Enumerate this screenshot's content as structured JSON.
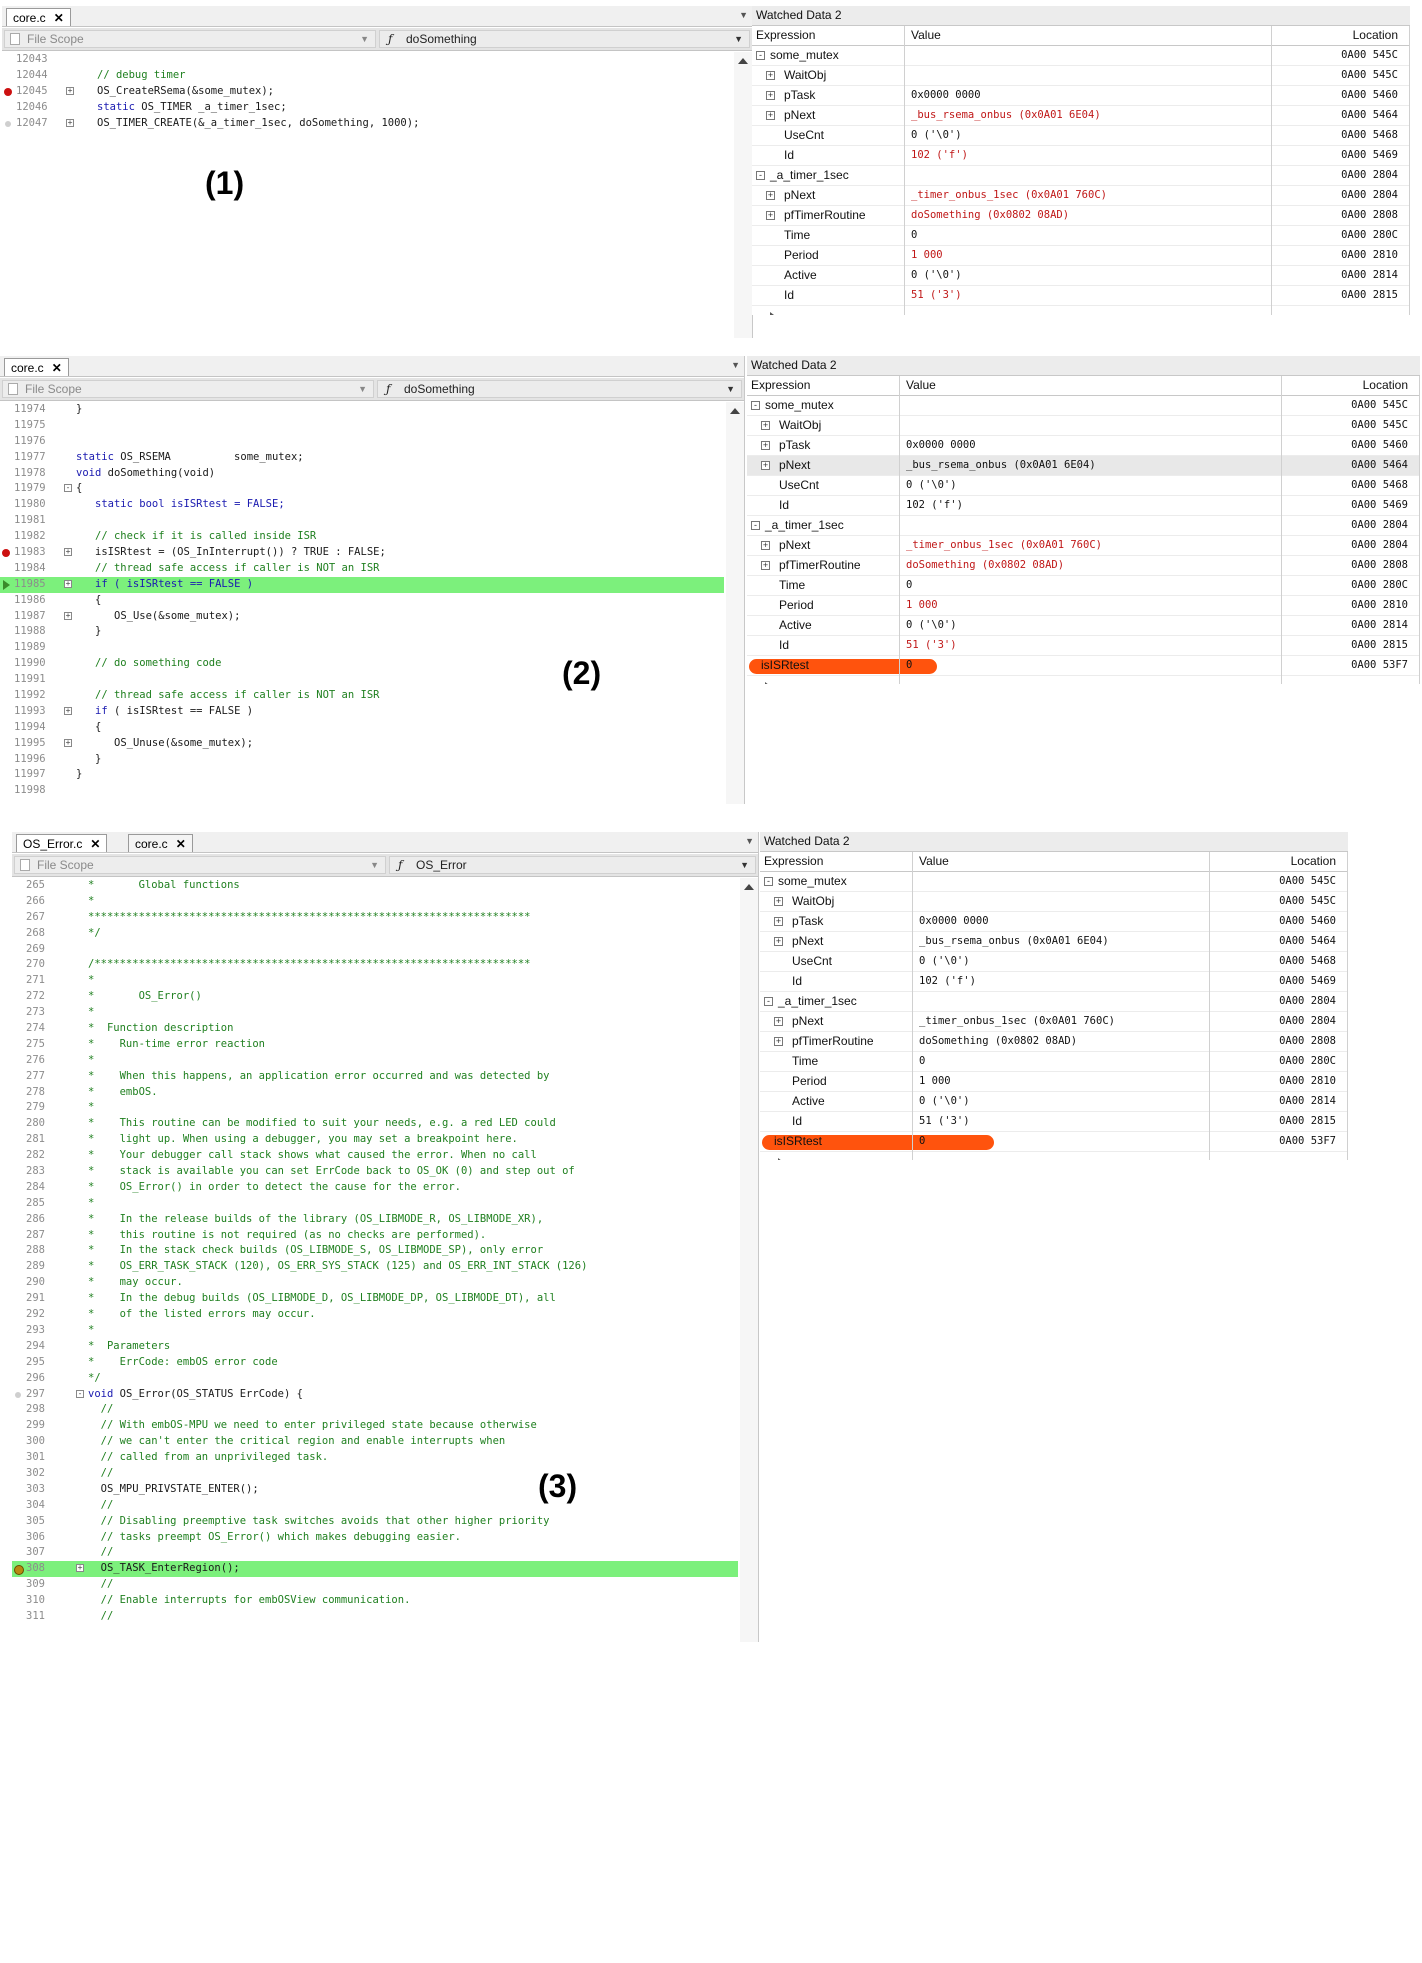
{
  "panels": [
    {
      "label": "(1)",
      "tabs": [
        {
          "name": "core.c",
          "close": "✕"
        }
      ],
      "scope": {
        "left": "File Scope",
        "right": "doSomething"
      },
      "code": [
        {
          "num": "12043",
          "text": "",
          "gutter": ""
        },
        {
          "num": "12044",
          "text": "// debug timer",
          "gutter": "",
          "cls": "cm",
          "indent": 2
        },
        {
          "num": "12045",
          "text": "OS_CreateRSema(&some_mutex);",
          "gutter": "bp",
          "fold": "+",
          "indent": 2
        },
        {
          "num": "12046",
          "text": "static OS_TIMER _a_timer_1sec;",
          "gutter": "",
          "kwtext": "static",
          "indent": 2
        },
        {
          "num": "12047",
          "text": "OS_TIMER_CREATE(&_a_timer_1sec, doSomething, 1000);",
          "gutter": "dot",
          "fold": "+",
          "indent": 2
        }
      ],
      "watch": {
        "title": "Watched Data 2",
        "headers": {
          "expression": "Expression",
          "value": "Value",
          "location": "Location"
        },
        "rows": [
          {
            "lvl": 0,
            "exp": "-",
            "name": "some_mutex",
            "value": "",
            "loc": "0A00 545C"
          },
          {
            "lvl": 1,
            "exp": "+",
            "name": "WaitObj",
            "value": "",
            "loc": "0A00 545C"
          },
          {
            "lvl": 1,
            "exp": "+",
            "name": "pTask",
            "value": "0x0000 0000",
            "loc": "0A00 5460"
          },
          {
            "lvl": 1,
            "exp": "+",
            "name": "pNext",
            "value": "_bus_rsema_onbus (0x0A01 6E04)",
            "red": true,
            "loc": "0A00 5464"
          },
          {
            "lvl": 1,
            "exp": "",
            "name": "UseCnt",
            "value": "0 ('\\0')",
            "loc": "0A00 5468"
          },
          {
            "lvl": 1,
            "exp": "",
            "name": "Id",
            "value": "102 ('f')",
            "red": true,
            "loc": "0A00 5469"
          },
          {
            "lvl": 0,
            "exp": "-",
            "name": "_a_timer_1sec",
            "value": "",
            "loc": "0A00 2804"
          },
          {
            "lvl": 1,
            "exp": "+",
            "name": "pNext",
            "value": "_timer_onbus_1sec (0x0A01 760C)",
            "red": true,
            "loc": "0A00 2804"
          },
          {
            "lvl": 1,
            "exp": "+",
            "name": "pfTimerRoutine",
            "value": "doSomething (0x0802 08AD)",
            "red": true,
            "loc": "0A00 2808"
          },
          {
            "lvl": 1,
            "exp": "",
            "name": "Time",
            "value": "0",
            "loc": "0A00 280C"
          },
          {
            "lvl": 1,
            "exp": "",
            "name": "Period",
            "value": "1 000",
            "red": true,
            "loc": "0A00 2810"
          },
          {
            "lvl": 1,
            "exp": "",
            "name": "Active",
            "value": "0 ('\\0')",
            "loc": "0A00 2814"
          },
          {
            "lvl": 1,
            "exp": "",
            "name": "Id",
            "value": "51 ('3')",
            "red": true,
            "loc": "0A00 2815"
          }
        ]
      }
    },
    {
      "label": "(2)",
      "tabs": [
        {
          "name": "core.c",
          "close": "✕"
        }
      ],
      "scope": {
        "left": "File Scope",
        "right": "doSomething"
      },
      "code": [
        {
          "num": "11974",
          "text": "}",
          "indent": 0
        },
        {
          "num": "11975",
          "text": ""
        },
        {
          "num": "11976",
          "text": ""
        },
        {
          "num": "11977",
          "text": "static OS_RSEMA          some_mutex;",
          "indent": 0
        },
        {
          "num": "11978",
          "text": "void doSomething(void)",
          "indent": 0
        },
        {
          "num": "11979",
          "text": "{",
          "fold": "-",
          "indent": 0
        },
        {
          "num": "11980",
          "text": "static bool isISRtest = FALSE;",
          "indent": 2,
          "cls": "kw"
        },
        {
          "num": "11981",
          "text": ""
        },
        {
          "num": "11982",
          "text": "// check if it is called inside ISR",
          "indent": 2,
          "cls": "cm"
        },
        {
          "num": "11983",
          "text": "isISRtest = (OS_InInterrupt()) ? TRUE : FALSE;",
          "indent": 2,
          "gutter": "bp",
          "fold": "+"
        },
        {
          "num": "11984",
          "text": "// thread safe access if caller is NOT an ISR",
          "indent": 2,
          "cls": "cm"
        },
        {
          "num": "11985",
          "text": "if ( isISRtest == FALSE )",
          "indent": 2,
          "gutter": "arrow",
          "fold": "+",
          "hl": true,
          "cls": "kw"
        },
        {
          "num": "11986",
          "text": "{",
          "indent": 2
        },
        {
          "num": "11987",
          "text": "OS_Use(&some_mutex);",
          "indent": 4,
          "fold": "+"
        },
        {
          "num": "11988",
          "text": "}",
          "indent": 2
        },
        {
          "num": "11989",
          "text": ""
        },
        {
          "num": "11990",
          "text": "// do something code",
          "indent": 2,
          "cls": "cm"
        },
        {
          "num": "11991",
          "text": ""
        },
        {
          "num": "11992",
          "text": "// thread safe access if caller is NOT an ISR",
          "indent": 2,
          "cls": "cm"
        },
        {
          "num": "11993",
          "text": "if ( isISRtest == FALSE )",
          "indent": 2,
          "fold": "+"
        },
        {
          "num": "11994",
          "text": "{",
          "indent": 2
        },
        {
          "num": "11995",
          "text": "OS_Unuse(&some_mutex);",
          "indent": 4,
          "fold": "+"
        },
        {
          "num": "11996",
          "text": "}",
          "indent": 2
        },
        {
          "num": "11997",
          "text": "}",
          "indent": 0
        },
        {
          "num": "11998",
          "text": ""
        }
      ],
      "watch": {
        "title": "Watched Data 2",
        "headers": {
          "expression": "Expression",
          "value": "Value",
          "location": "Location"
        },
        "rows": [
          {
            "lvl": 0,
            "exp": "-",
            "name": "some_mutex",
            "value": "",
            "loc": "0A00 545C"
          },
          {
            "lvl": 1,
            "exp": "+",
            "name": "WaitObj",
            "value": "",
            "loc": "0A00 545C"
          },
          {
            "lvl": 1,
            "exp": "+",
            "name": "pTask",
            "value": "0x0000 0000",
            "loc": "0A00 5460"
          },
          {
            "lvl": 1,
            "exp": "+",
            "name": "pNext",
            "value": "_bus_rsema_onbus (0x0A01 6E04)",
            "loc": "0A00 5464",
            "sel": true
          },
          {
            "lvl": 1,
            "exp": "",
            "name": "UseCnt",
            "value": "0 ('\\0')",
            "loc": "0A00 5468"
          },
          {
            "lvl": 1,
            "exp": "",
            "name": "Id",
            "value": "102 ('f')",
            "loc": "0A00 5469"
          },
          {
            "lvl": 0,
            "exp": "-",
            "name": "_a_timer_1sec",
            "value": "",
            "loc": "0A00 2804"
          },
          {
            "lvl": 1,
            "exp": "+",
            "name": "pNext",
            "value": "_timer_onbus_1sec (0x0A01 760C)",
            "red": true,
            "loc": "0A00 2804"
          },
          {
            "lvl": 1,
            "exp": "+",
            "name": "pfTimerRoutine",
            "value": "doSomething (0x0802 08AD)",
            "red": true,
            "loc": "0A00 2808"
          },
          {
            "lvl": 1,
            "exp": "",
            "name": "Time",
            "value": "0",
            "loc": "0A00 280C"
          },
          {
            "lvl": 1,
            "exp": "",
            "name": "Period",
            "value": "1 000",
            "red": true,
            "loc": "0A00 2810"
          },
          {
            "lvl": 1,
            "exp": "",
            "name": "Active",
            "value": "0 ('\\0')",
            "loc": "0A00 2814"
          },
          {
            "lvl": 1,
            "exp": "",
            "name": "Id",
            "value": "51 ('3')",
            "red": true,
            "loc": "0A00 2815"
          },
          {
            "lvl": 0,
            "exp": "",
            "name": "isISRtest",
            "value": "0",
            "loc": "0A00 53F7",
            "scribble": true
          }
        ]
      }
    },
    {
      "label": "(3)",
      "tabs": [
        {
          "name": "OS_Error.c",
          "close": "✕"
        },
        {
          "name": "core.c",
          "close": "✕"
        }
      ],
      "scope": {
        "left": "File Scope",
        "right": "OS_Error"
      },
      "code": [
        {
          "num": "265",
          "text": "*       Global functions",
          "cls": "cm"
        },
        {
          "num": "266",
          "text": "*",
          "cls": "cm"
        },
        {
          "num": "267",
          "text": "**********************************************************************",
          "cls": "cm"
        },
        {
          "num": "268",
          "text": "*/",
          "cls": "cm"
        },
        {
          "num": "269",
          "text": ""
        },
        {
          "num": "270",
          "text": "/*********************************************************************",
          "cls": "cm"
        },
        {
          "num": "271",
          "text": "*",
          "cls": "cm"
        },
        {
          "num": "272",
          "text": "*       OS_Error()",
          "cls": "cm"
        },
        {
          "num": "273",
          "text": "*",
          "cls": "cm"
        },
        {
          "num": "274",
          "text": "*  Function description",
          "cls": "cm"
        },
        {
          "num": "275",
          "text": "*    Run-time error reaction",
          "cls": "cm"
        },
        {
          "num": "276",
          "text": "*",
          "cls": "cm"
        },
        {
          "num": "277",
          "text": "*    When this happens, an application error occurred and was detected by",
          "cls": "cm"
        },
        {
          "num": "278",
          "text": "*    embOS.",
          "cls": "cm"
        },
        {
          "num": "279",
          "text": "*",
          "cls": "cm"
        },
        {
          "num": "280",
          "text": "*    This routine can be modified to suit your needs, e.g. a red LED could",
          "cls": "cm"
        },
        {
          "num": "281",
          "text": "*    light up. When using a debugger, you may set a breakpoint here.",
          "cls": "cm"
        },
        {
          "num": "282",
          "text": "*    Your debugger call stack shows what caused the error. When no call",
          "cls": "cm"
        },
        {
          "num": "283",
          "text": "*    stack is available you can set ErrCode back to OS_OK (0) and step out of",
          "cls": "cm"
        },
        {
          "num": "284",
          "text": "*    OS_Error() in order to detect the cause for the error.",
          "cls": "cm"
        },
        {
          "num": "285",
          "text": "*",
          "cls": "cm"
        },
        {
          "num": "286",
          "text": "*    In the release builds of the library (OS_LIBMODE_R, OS_LIBMODE_XR),",
          "cls": "cm"
        },
        {
          "num": "287",
          "text": "*    this routine is not required (as no checks are performed).",
          "cls": "cm"
        },
        {
          "num": "288",
          "text": "*    In the stack check builds (OS_LIBMODE_S, OS_LIBMODE_SP), only error",
          "cls": "cm"
        },
        {
          "num": "289",
          "text": "*    OS_ERR_TASK_STACK (120), OS_ERR_SYS_STACK (125) and OS_ERR_INT_STACK (126)",
          "cls": "cm"
        },
        {
          "num": "290",
          "text": "*    may occur.",
          "cls": "cm"
        },
        {
          "num": "291",
          "text": "*    In the debug builds (OS_LIBMODE_D, OS_LIBMODE_DP, OS_LIBMODE_DT), all",
          "cls": "cm"
        },
        {
          "num": "292",
          "text": "*    of the listed errors may occur.",
          "cls": "cm"
        },
        {
          "num": "293",
          "text": "*",
          "cls": "cm"
        },
        {
          "num": "294",
          "text": "*  Parameters",
          "cls": "cm"
        },
        {
          "num": "295",
          "text": "*    ErrCode: embOS error code",
          "cls": "cm"
        },
        {
          "num": "296",
          "text": "*/",
          "cls": "cm"
        },
        {
          "num": "297",
          "text": "void OS_Error(OS_STATUS ErrCode) {",
          "gutter": "dot",
          "fold": "-"
        },
        {
          "num": "298",
          "text": "  //",
          "cls": "cm"
        },
        {
          "num": "299",
          "text": "  // With embOS-MPU we need to enter privileged state because otherwise",
          "cls": "cm"
        },
        {
          "num": "300",
          "text": "  // we can't enter the critical region and enable interrupts when",
          "cls": "cm"
        },
        {
          "num": "301",
          "text": "  // called from an unprivileged task.",
          "cls": "cm"
        },
        {
          "num": "302",
          "text": "  //",
          "cls": "cm"
        },
        {
          "num": "303",
          "text": "  OS_MPU_PRIVSTATE_ENTER();"
        },
        {
          "num": "304",
          "text": "  //",
          "cls": "cm"
        },
        {
          "num": "305",
          "text": "  // Disabling preemptive task switches avoids that other higher priority",
          "cls": "cm"
        },
        {
          "num": "306",
          "text": "  // tasks preempt OS_Error() which makes debugging easier.",
          "cls": "cm"
        },
        {
          "num": "307",
          "text": "  //",
          "cls": "cm"
        },
        {
          "num": "308",
          "text": "  OS_TASK_EnterRegion();",
          "gutter": "pc",
          "fold": "+",
          "hl": true
        },
        {
          "num": "309",
          "text": "  //",
          "cls": "cm"
        },
        {
          "num": "310",
          "text": "  // Enable interrupts for embOSView communication.",
          "cls": "cm"
        },
        {
          "num": "311",
          "text": "  //",
          "cls": "cm"
        }
      ],
      "watch": {
        "title": "Watched Data 2",
        "headers": {
          "expression": "Expression",
          "value": "Value",
          "location": "Location"
        },
        "rows": [
          {
            "lvl": 0,
            "exp": "-",
            "name": "some_mutex",
            "value": "",
            "loc": "0A00 545C"
          },
          {
            "lvl": 1,
            "exp": "+",
            "name": "WaitObj",
            "value": "",
            "loc": "0A00 545C"
          },
          {
            "lvl": 1,
            "exp": "+",
            "name": "pTask",
            "value": "0x0000 0000",
            "loc": "0A00 5460"
          },
          {
            "lvl": 1,
            "exp": "+",
            "name": "pNext",
            "value": "_bus_rsema_onbus (0x0A01 6E04)",
            "loc": "0A00 5464"
          },
          {
            "lvl": 1,
            "exp": "",
            "name": "UseCnt",
            "value": "0 ('\\0')",
            "loc": "0A00 5468"
          },
          {
            "lvl": 1,
            "exp": "",
            "name": "Id",
            "value": "102 ('f')",
            "loc": "0A00 5469"
          },
          {
            "lvl": 0,
            "exp": "-",
            "name": "_a_timer_1sec",
            "value": "",
            "loc": "0A00 2804"
          },
          {
            "lvl": 1,
            "exp": "+",
            "name": "pNext",
            "value": "_timer_onbus_1sec (0x0A01 760C)",
            "loc": "0A00 2804"
          },
          {
            "lvl": 1,
            "exp": "+",
            "name": "pfTimerRoutine",
            "value": "doSomething (0x0802 08AD)",
            "loc": "0A00 2808"
          },
          {
            "lvl": 1,
            "exp": "",
            "name": "Time",
            "value": "0",
            "loc": "0A00 280C"
          },
          {
            "lvl": 1,
            "exp": "",
            "name": "Period",
            "value": "1 000",
            "loc": "0A00 2810"
          },
          {
            "lvl": 1,
            "exp": "",
            "name": "Active",
            "value": "0 ('\\0')",
            "loc": "0A00 2814"
          },
          {
            "lvl": 1,
            "exp": "",
            "name": "Id",
            "value": "51 ('3')",
            "loc": "0A00 2815"
          },
          {
            "lvl": 0,
            "exp": "",
            "name": "isISRtest",
            "value": "0",
            "loc": "0A00 53F7",
            "scribble": true
          }
        ]
      }
    }
  ],
  "colors": {
    "highlight": "#7cf07c",
    "comment": "#208020",
    "keyword": "#1a1ab0",
    "changed_value": "#c01818",
    "annotation": "#ff4a00"
  }
}
